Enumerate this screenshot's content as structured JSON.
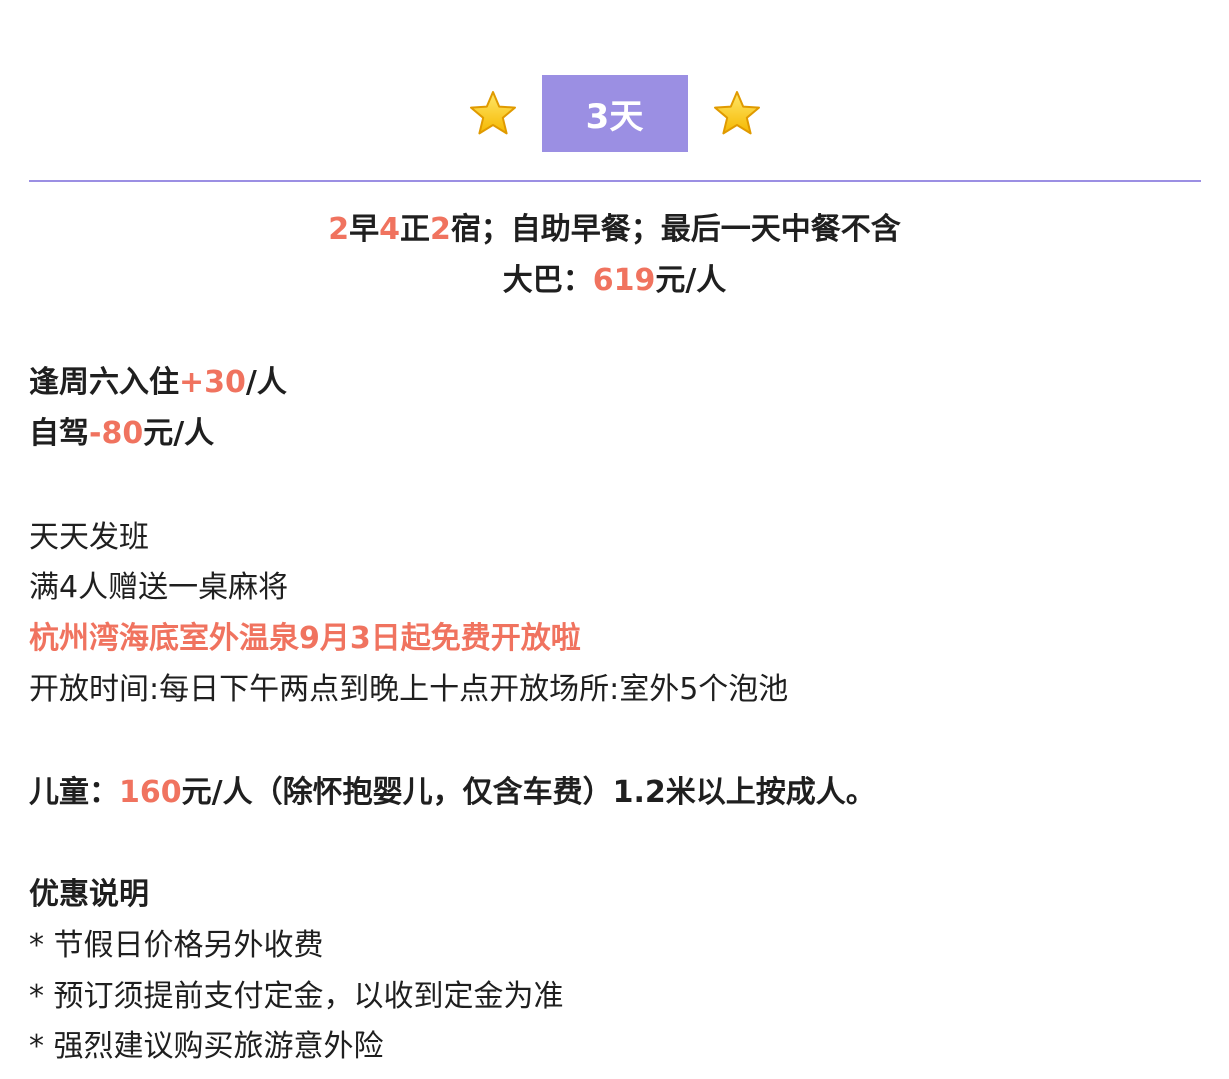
{
  "header": {
    "day_label": "3天",
    "left_icon": "star-icon",
    "right_icon": "star-icon",
    "badge_color": "#9b8fe3"
  },
  "colors": {
    "accent": "#f0735f",
    "divider": "#9b8fe3"
  },
  "meals": {
    "n1": "2",
    "t1": "早",
    "n2": "4",
    "t2": "正",
    "n3": "2",
    "t3": "宿；自助早餐；最后一天中餐不含"
  },
  "bus": {
    "label": "大巴：",
    "price": "619",
    "unit": "元/人"
  },
  "saturday": {
    "label": "逢周六入住",
    "extra": "+30",
    "unit": "/人"
  },
  "self_drive": {
    "label": "自驾",
    "discount": "-80",
    "unit": "元/人"
  },
  "info": {
    "daily": "天天发班",
    "mahjong": "满4人赠送一桌麻将",
    "hot_spring": "杭州湾海底室外温泉9月3日起免费开放啦",
    "hours": "开放时间:每日下午两点到晚上十点开放场所:室外5个泡池"
  },
  "child": {
    "label": "儿童：",
    "price": "160",
    "rest": "元/人（除怀抱婴儿，仅含车费）1.2米以上按成人。"
  },
  "discount": {
    "title": "优惠说明",
    "items": [
      "*  节假日价格另外收费",
      "*  预订须提前支付定金，以收到定金为准",
      "*  强烈建议购买旅游意外险"
    ]
  }
}
